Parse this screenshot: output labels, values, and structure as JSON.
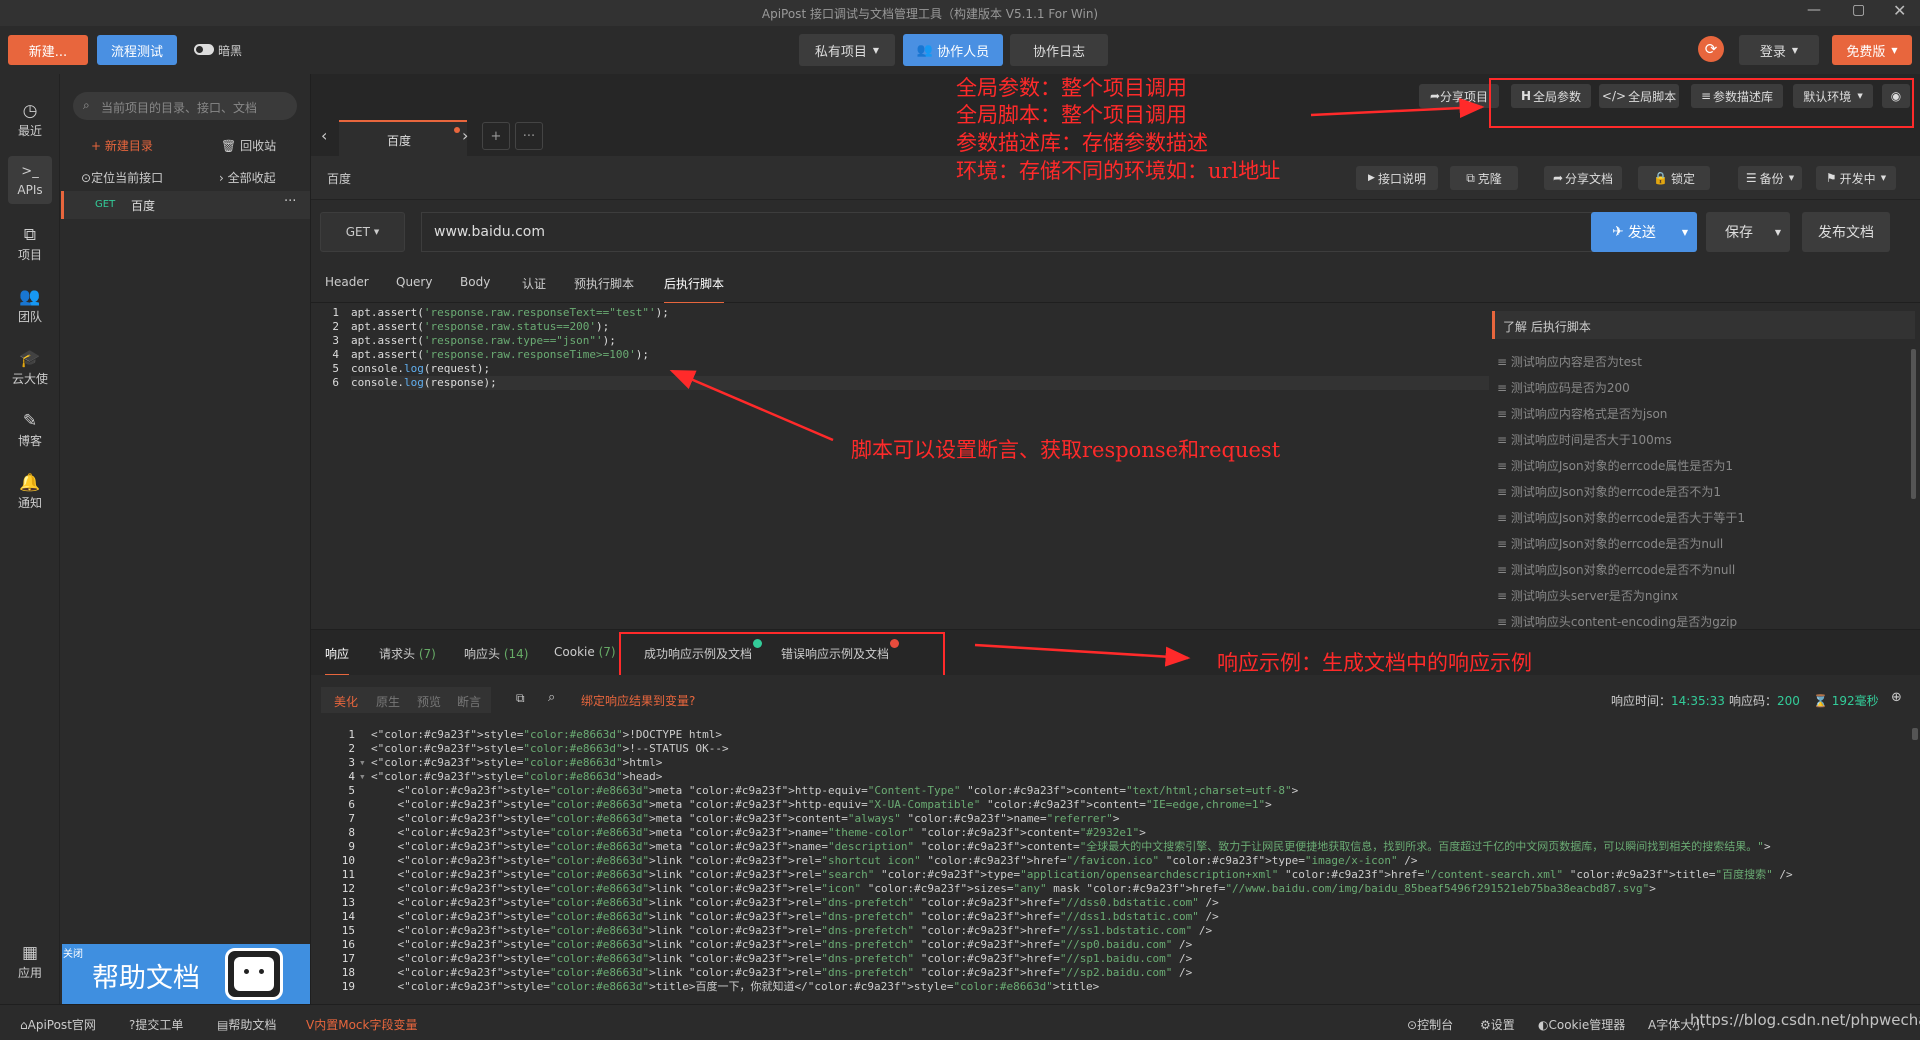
{
  "window": {
    "title": "ApiPost 接口调试与文档管理工具（构建版本 V5.1.1 For Win)"
  },
  "toolbar": {
    "new_label": "新建...",
    "flow_test_label": "流程测试",
    "dark_label": "暗黑",
    "private_project_label": "私有项目",
    "collaborators_label": "协作人员",
    "collab_log_label": "协作日志",
    "login_label": "登录",
    "free_label": "免费版"
  },
  "sidebar": {
    "items": [
      {
        "icon": "clock-icon",
        "label": "最近"
      },
      {
        "icon": "terminal-icon",
        "label": "APIs"
      },
      {
        "icon": "project-icon",
        "label": "项目"
      },
      {
        "icon": "team-icon",
        "label": "团队"
      },
      {
        "icon": "mortarboard-icon",
        "label": "云大使"
      },
      {
        "icon": "edit-icon",
        "label": "博客"
      },
      {
        "icon": "bell-icon",
        "label": "通知"
      },
      {
        "icon": "grid-icon",
        "label": "应用"
      }
    ]
  },
  "tree": {
    "search_placeholder": "当前项目的目录、接口、文档",
    "new_dir": "新建目录",
    "recycle": "回收站",
    "locate": "定位当前接口",
    "collapse": "全部收起",
    "item": {
      "method": "GET",
      "name": "百度"
    }
  },
  "banner": {
    "close": "关闭",
    "text": "帮助文档"
  },
  "tabs": {
    "active": "百度",
    "plus": "+",
    "more": "···"
  },
  "project_tools": {
    "share_project": "分享项目",
    "global_params": "全局参数",
    "global_script": "全局脚本",
    "param_lib": "参数描述库",
    "env": "默认环境"
  },
  "breadcrumb": "百度",
  "api_tools": {
    "desc": "接口说明",
    "clone": "克隆",
    "share_doc": "分享文档",
    "lock": "锁定",
    "backup": "备份",
    "status": "开发中"
  },
  "request": {
    "method": "GET",
    "url": "www.baidu.com",
    "send": "发送",
    "save": "保存",
    "publish": "发布文档"
  },
  "req_tabs": [
    "Header",
    "Query",
    "Body",
    "认证",
    "预执行脚本",
    "后执行脚本"
  ],
  "script": {
    "lines": [
      {
        "n": "1",
        "parts": [
          {
            "t": "apt.assert(",
            "c": "#ddd"
          },
          {
            "t": "'response.raw.responseText==\"test\"'",
            "c": "#6aab73"
          },
          {
            "t": ");",
            "c": "#ddd"
          }
        ]
      },
      {
        "n": "2",
        "parts": [
          {
            "t": "apt.assert(",
            "c": "#ddd"
          },
          {
            "t": "'response.raw.status==200'",
            "c": "#6aab73"
          },
          {
            "t": ");",
            "c": "#ddd"
          }
        ]
      },
      {
        "n": "3",
        "parts": [
          {
            "t": "apt.assert(",
            "c": "#ddd"
          },
          {
            "t": "'response.raw.type==\"json\"'",
            "c": "#6aab73"
          },
          {
            "t": ");",
            "c": "#ddd"
          }
        ]
      },
      {
        "n": "4",
        "parts": [
          {
            "t": "apt.assert(",
            "c": "#ddd"
          },
          {
            "t": "'response.raw.responseTime>=100'",
            "c": "#6aab73"
          },
          {
            "t": ");",
            "c": "#ddd"
          }
        ]
      },
      {
        "n": "5",
        "parts": [
          {
            "t": "console.",
            "c": "#ddd"
          },
          {
            "t": "log",
            "c": "#61afef"
          },
          {
            "t": "(request);",
            "c": "#ddd"
          }
        ]
      },
      {
        "n": "6",
        "parts": [
          {
            "t": "console.",
            "c": "#ddd"
          },
          {
            "t": "log",
            "c": "#61afef"
          },
          {
            "t": "(response);",
            "c": "#ddd"
          }
        ]
      }
    ]
  },
  "hints": {
    "header": "了解 后执行脚本",
    "items": [
      "测试响应内容是否为test",
      "测试响应码是否为200",
      "测试响应内容格式是否为json",
      "测试响应时间是否大于100ms",
      "测试响应Json对象的errcode属性是否为1",
      "测试响应Json对象的errcode是否不为1",
      "测试响应Json对象的errcode是否大于等于1",
      "测试响应Json对象的errcode是否为null",
      "测试响应Json对象的errcode是否不为null",
      "测试响应头server是否为nginx",
      "测试响应头content-encoding是否为gzip"
    ]
  },
  "resp_tabs": {
    "response": "响应",
    "req_headers": "请求头",
    "req_headers_count": "(7)",
    "resp_headers": "响应头",
    "resp_headers_count": "(14)",
    "cookie": "Cookie",
    "cookie_count": "(7)",
    "success_example": "成功响应示例及文档",
    "error_example": "错误响应示例及文档"
  },
  "resp_bar": {
    "modes": [
      "美化",
      "原生",
      "预览",
      "断言"
    ],
    "bind": "绑定响应结果到变量?",
    "time_label": "响应时间：",
    "time_value": "14:35:33",
    "code_label": "响应码：",
    "code_value": "200",
    "duration": "192毫秒"
  },
  "response_code": [
    "<!DOCTYPE html>",
    "<!--STATUS OK-->",
    "<html>",
    "<head>",
    "    <meta http-equiv=\"Content-Type\" content=\"text/html;charset=utf-8\">",
    "    <meta http-equiv=\"X-UA-Compatible\" content=\"IE=edge,chrome=1\">",
    "    <meta content=\"always\" name=\"referrer\">",
    "    <meta name=\"theme-color\" content=\"#2932e1\">",
    "    <meta name=\"description\" content=\"全球最大的中文搜索引擎、致力于让网民更便捷地获取信息，找到所求。百度超过千亿的中文网页数据库，可以瞬间找到相关的搜索结果。\">",
    "    <link rel=\"shortcut icon\" href=\"/favicon.ico\" type=\"image/x-icon\" />",
    "    <link rel=\"search\" type=\"application/opensearchdescription+xml\" href=\"/content-search.xml\" title=\"百度搜索\" />",
    "    <link rel=\"icon\" sizes=\"any\" mask href=\"//www.baidu.com/img/baidu_85beaf5496f291521eb75ba38eacbd87.svg\">",
    "    <link rel=\"dns-prefetch\" href=\"//dss0.bdstatic.com\" />",
    "    <link rel=\"dns-prefetch\" href=\"//dss1.bdstatic.com\" />",
    "    <link rel=\"dns-prefetch\" href=\"//ss1.bdstatic.com\" />",
    "    <link rel=\"dns-prefetch\" href=\"//sp0.baidu.com\" />",
    "    <link rel=\"dns-prefetch\" href=\"//sp1.baidu.com\" />",
    "    <link rel=\"dns-prefetch\" href=\"//sp2.baidu.com\" />",
    "    <title>百度一下，你就知道</title>"
  ],
  "annotations": {
    "top": [
      "全局参数：整个项目调用",
      "全局脚本：整个项目调用",
      "参数描述库：存储参数描述",
      "环境：存储不同的环境如：url地址"
    ],
    "middle": "脚本可以设置断言、获取response和request",
    "bottom": "响应示例：生成文档中的响应示例"
  },
  "statusbar": {
    "left": [
      "ApiPost官网",
      "提交工单",
      "帮助文档",
      "内置Mock字段变量"
    ],
    "right": [
      "控制台",
      "设置",
      "Cookie管理器",
      "字体大小"
    ],
    "watermark": "https://blog.csdn.net/phpwechat"
  },
  "colors": {
    "accent_orange": "#e8663d",
    "accent_blue": "#4a90e2",
    "annotation_red": "#ff2a2a"
  }
}
